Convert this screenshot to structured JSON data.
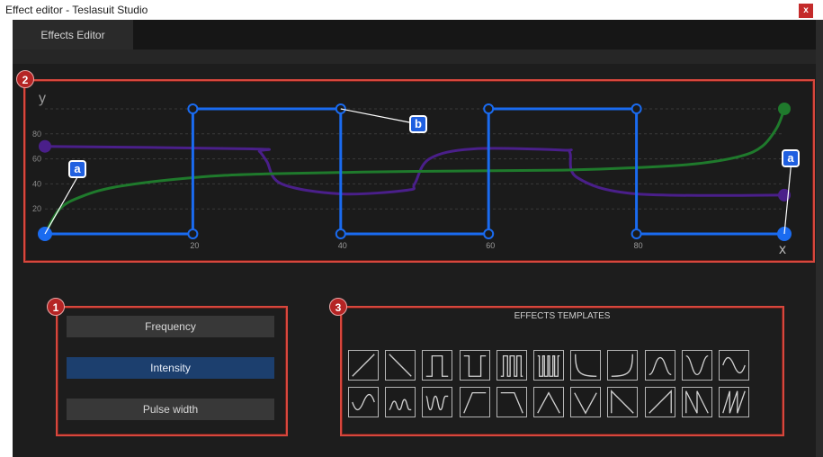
{
  "window": {
    "title": "Effect editor - Teslasuit Studio",
    "close_label": "x"
  },
  "tabs": [
    {
      "label": "Effects Editor",
      "active": true
    }
  ],
  "badges": {
    "one": "1",
    "two": "2",
    "three": "3"
  },
  "callouts": {
    "a_left": "a",
    "a_right": "a",
    "b": "b"
  },
  "chart_data": {
    "type": "line",
    "xlabel": "x",
    "ylabel": "y",
    "xlim": [
      0,
      100
    ],
    "ylim": [
      0,
      100
    ],
    "x_ticks": [
      20,
      40,
      60,
      80
    ],
    "y_ticks": [
      20,
      40,
      60,
      80
    ],
    "grid": true,
    "series": [
      {
        "color": "#1a6bf0",
        "points": [
          [
            0,
            0
          ],
          [
            20,
            0
          ],
          [
            20,
            100
          ],
          [
            40,
            100
          ],
          [
            40,
            0
          ],
          [
            60,
            0
          ],
          [
            60,
            100
          ],
          [
            80,
            100
          ],
          [
            80,
            0
          ],
          [
            100,
            0
          ]
        ]
      },
      {
        "color": "#1f7a2c",
        "points": [
          [
            0,
            0
          ],
          [
            2,
            20
          ],
          [
            5,
            30
          ],
          [
            10,
            38
          ],
          [
            20,
            45
          ],
          [
            30,
            48
          ],
          [
            50,
            50
          ],
          [
            70,
            51
          ],
          [
            80,
            53
          ],
          [
            88,
            56
          ],
          [
            94,
            62
          ],
          [
            97,
            70
          ],
          [
            99,
            85
          ],
          [
            100,
            100
          ]
        ]
      },
      {
        "color": "#4a1f8a",
        "points": [
          [
            0,
            70
          ],
          [
            28,
            68
          ],
          [
            29,
            66
          ],
          [
            30,
            58
          ],
          [
            32,
            40
          ],
          [
            40,
            32
          ],
          [
            49,
            35
          ],
          [
            50,
            40
          ],
          [
            52,
            60
          ],
          [
            58,
            68
          ],
          [
            70,
            67
          ],
          [
            71,
            65
          ],
          [
            72,
            45
          ],
          [
            80,
            32
          ],
          [
            100,
            31
          ]
        ]
      }
    ]
  },
  "parameters": {
    "buttons": [
      {
        "label": "Frequency",
        "active": false
      },
      {
        "label": "Intensity",
        "active": true
      },
      {
        "label": "Pulse width",
        "active": false
      }
    ]
  },
  "templates": {
    "title": "EFFECTS TEMPLATES",
    "row1": [
      "ramp-up",
      "ramp-down",
      "square-pulse",
      "square-pulse-narrow",
      "square-pulse-train",
      "square-pulse-train-dense",
      "decay-curve",
      "rise-curve",
      "sine-bump",
      "sine-dip",
      "sine-wave"
    ],
    "row2": [
      "sine-wave-inverted",
      "square-wave-small",
      "rounded-pulse-train",
      "ramp-up-hold",
      "hold-ramp-down",
      "triangle",
      "triangle-inverted",
      "sawtooth-down",
      "sawtooth-up",
      "zigzag-down",
      "zigzag-up"
    ]
  },
  "colors": {
    "accent": "#1a6bf0",
    "highlight": "#d8473d",
    "active_button": "#1c3f6e"
  }
}
